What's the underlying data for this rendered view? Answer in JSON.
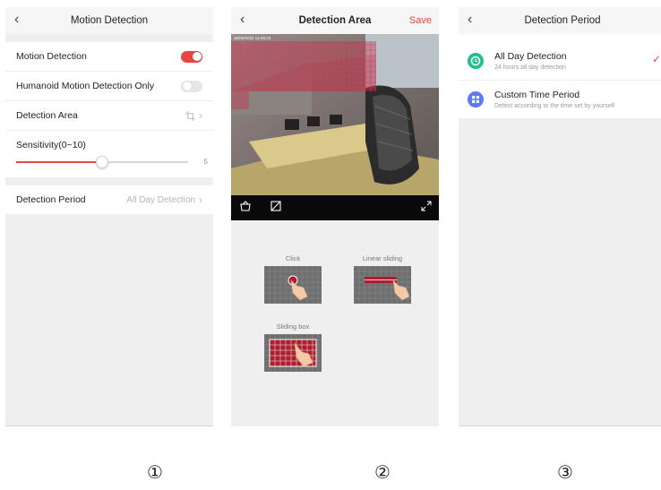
{
  "accent_color": "#e8463f",
  "panel1": {
    "back_icon": "chevron-left-icon",
    "title": "Motion Detection",
    "motion_detection_label": "Motion Detection",
    "motion_detection_on": true,
    "humanoid_label": "Humanoid Motion Detection Only",
    "humanoid_on": false,
    "detection_area_label": "Detection Area",
    "detection_area_icon": "crop-icon",
    "sensitivity_label": "Sensitivity(0~10)",
    "sensitivity_value": 5,
    "sensitivity_min": 0,
    "sensitivity_max": 10,
    "sensitivity_value_text": "5",
    "detection_period_label": "Detection Period",
    "detection_period_value": "All Day Detection"
  },
  "panel2": {
    "back_icon": "chevron-left-icon",
    "title": "Detection Area",
    "save_label": "Save",
    "timestamp": "26/05/2022 12:46:03",
    "toolbar_icons": [
      "basket-icon",
      "erase-icon",
      "fullscreen-icon"
    ],
    "guides": [
      {
        "label": "Click"
      },
      {
        "label": "Linear sliding"
      },
      {
        "label": "Sliding box"
      }
    ]
  },
  "panel3": {
    "back_icon": "chevron-left-icon",
    "title": "Detection Period",
    "options": [
      {
        "title": "All Day Detection",
        "subtitle": "24 hours all day detection",
        "color": "#1fbf8f",
        "icon": "clock-icon",
        "selected": true
      },
      {
        "title": "Custom Time Period",
        "subtitle": "Detect according to the time set by yourself",
        "color": "#5b7cf0",
        "icon": "grid-icon",
        "selected": false
      }
    ]
  },
  "captions": [
    "①",
    "②",
    "③"
  ]
}
